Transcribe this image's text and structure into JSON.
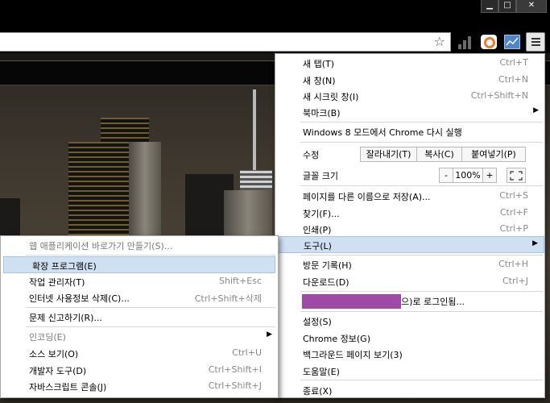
{
  "window": {
    "min_glyph": "▁",
    "max_glyph": "□",
    "close_glyph": "✕"
  },
  "toolbar": {
    "star_icon": "star-icon",
    "bookmark_glyph": "☆"
  },
  "main_menu": {
    "new_tab": "새 탭(T)",
    "new_tab_sc": "Ctrl+T",
    "new_window": "새 창(N)",
    "new_window_sc": "Ctrl+N",
    "incognito": "새 시크릿 창(I)",
    "incognito_sc": "Ctrl+Shift+N",
    "bookmarks": "북마크(B)",
    "relaunch": "Windows 8 모드에서 Chrome 다시 실행",
    "edit": "수정",
    "cut": "잘라내기(T)",
    "copy": "복사(C)",
    "paste": "붙여넣기(P)",
    "zoom": "글꼴 크기",
    "zoom_minus": "-",
    "zoom_value": "100%",
    "zoom_plus": "+",
    "save_as": "페이지를 다른 이름으로 저장(A)...",
    "save_as_sc": "Ctrl+S",
    "find": "찾기(F)...",
    "find_sc": "Ctrl+F",
    "print": "인쇄(P)",
    "print_sc": "Ctrl+P",
    "tools": "도구(L)",
    "history": "방문 기록(H)",
    "history_sc": "Ctrl+H",
    "downloads": "다운로드(D)",
    "downloads_sc": "Ctrl+J",
    "signed_in": "으)로 로그인됨...",
    "settings": "설정(S)",
    "about": "Chrome 정보(G)",
    "background_pages": "백그라운드 페이지 보기(3)",
    "help": "도움말(E)",
    "exit": "종료(X)"
  },
  "tools_menu": {
    "create_shortcut": "웹 애플리케이션 바로가기 만들기(S)...",
    "extensions": "확장 프로그램(E)",
    "task_manager": "작업 관리자(T)",
    "task_manager_sc": "Shift+Esc",
    "clear_data": "인터넷 사용정보 삭제(C)...",
    "clear_data_sc": "Ctrl+Shift+삭제",
    "report_issue": "문제 신고하기(R)...",
    "encoding": "인코딩(E)",
    "view_source": "소스 보기(O)",
    "view_source_sc": "Ctrl+U",
    "dev_tools": "개발자 도구(D)",
    "dev_tools_sc": "Ctrl+Shift+I",
    "js_console": "자바스크립트 콘솔(J)",
    "js_console_sc": "Ctrl+Shift+J"
  },
  "colors": {
    "highlight": "#cfe0f3",
    "account_redacted": "#a04aa8"
  }
}
